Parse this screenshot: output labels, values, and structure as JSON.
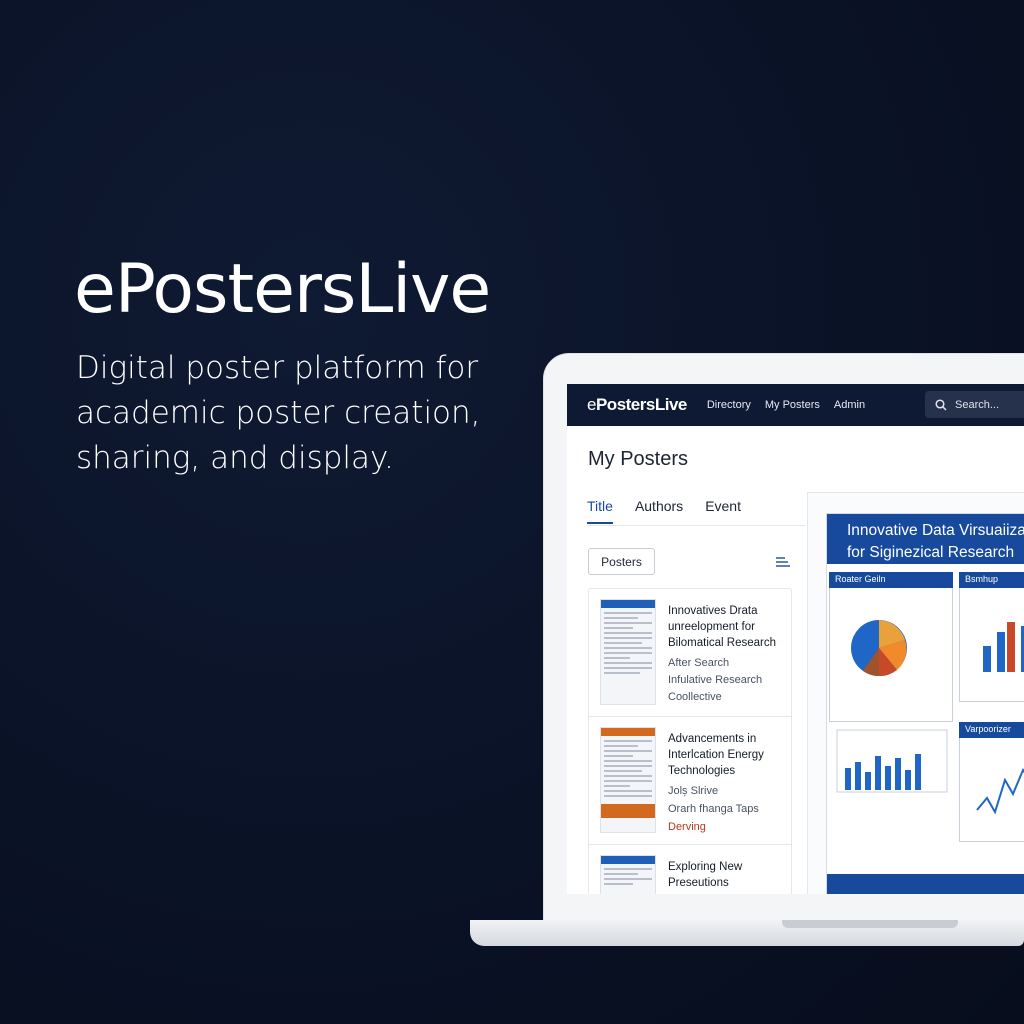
{
  "hero": {
    "title": "ePostersLive",
    "subtitle": "Digital poster platform for academic poster creation, sharing, and display."
  },
  "nav": {
    "logo_prefix": "e",
    "logo_rest": "PostersLive",
    "links": [
      "Directory",
      "My Posters",
      "Admin"
    ],
    "search_placeholder": "Search..."
  },
  "page": {
    "title": "My Posters",
    "tabs": [
      "Title",
      "Authors",
      "Event"
    ],
    "active_tab": "Title",
    "filter_label": "Posters"
  },
  "posters": [
    {
      "title": "Innovatives Drata unreelopment for Bilomatical Research",
      "meta": [
        "After Search",
        "Infulative Research",
        "Coollective"
      ],
      "thumb_color": "#1f5fb8"
    },
    {
      "title": "Advancements in Interlcation Energy Technologies",
      "meta": [
        "Jolș Slrive",
        "Orarh fhanga Taps",
        "Derving"
      ],
      "thumb_color": "#d2691e"
    },
    {
      "title": "Exploring New Preseutions",
      "meta": [],
      "thumb_color": "#1f5fb8"
    }
  ],
  "preview": {
    "title_line1": "Innovative Data Virsuaiizations",
    "title_line2": "for Siginezical Research",
    "sections": [
      "Roater Geiln",
      "Bsmhup",
      "Varpoorizer"
    ]
  },
  "colors": {
    "background": "#0a1226",
    "nav": "#0e1a33",
    "accent": "#174a9c",
    "secondary": "#b23a1e"
  }
}
